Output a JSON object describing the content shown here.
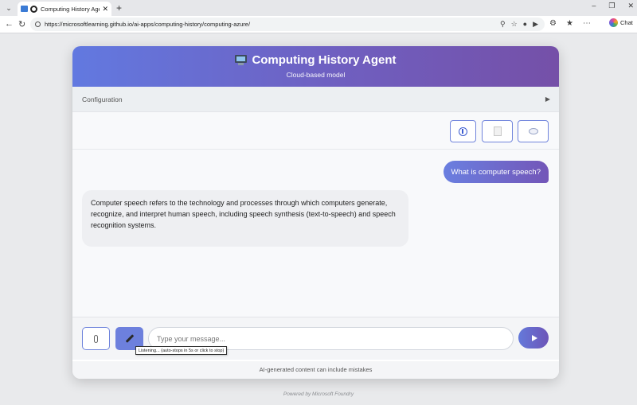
{
  "browser": {
    "tab_title": "Computing History Agent - AI",
    "url": "https://microsoftlearning.github.io/ai-apps/computing-history/computing-azure/",
    "chat_label": "Chat"
  },
  "app": {
    "title": "Computing History Agent",
    "subtitle": "Cloud-based model",
    "config_label": "Configuration",
    "toolbar_icons": [
      "info-icon",
      "document-icon",
      "speech-bubble-icon"
    ]
  },
  "messages": [
    {
      "role": "user",
      "text": "What is computer speech?"
    },
    {
      "role": "assistant",
      "text": "Computer speech refers to the technology and processes through which computers generate, recognize, and interpret human speech, including speech synthesis (text-to-speech) and speech recognition systems."
    }
  ],
  "input": {
    "placeholder": "Type your message...",
    "value": "",
    "mic_tooltip": "Listening... (auto-stops in 5s or click to stop)"
  },
  "footer": {
    "disclaimer": "AI-generated content can include mistakes",
    "powered_by": "Powered by Microsoft Foundry"
  },
  "colors": {
    "header_gradient_start": "#6279e0",
    "header_gradient_end": "#7550a8",
    "accent": "#6d80dd"
  }
}
